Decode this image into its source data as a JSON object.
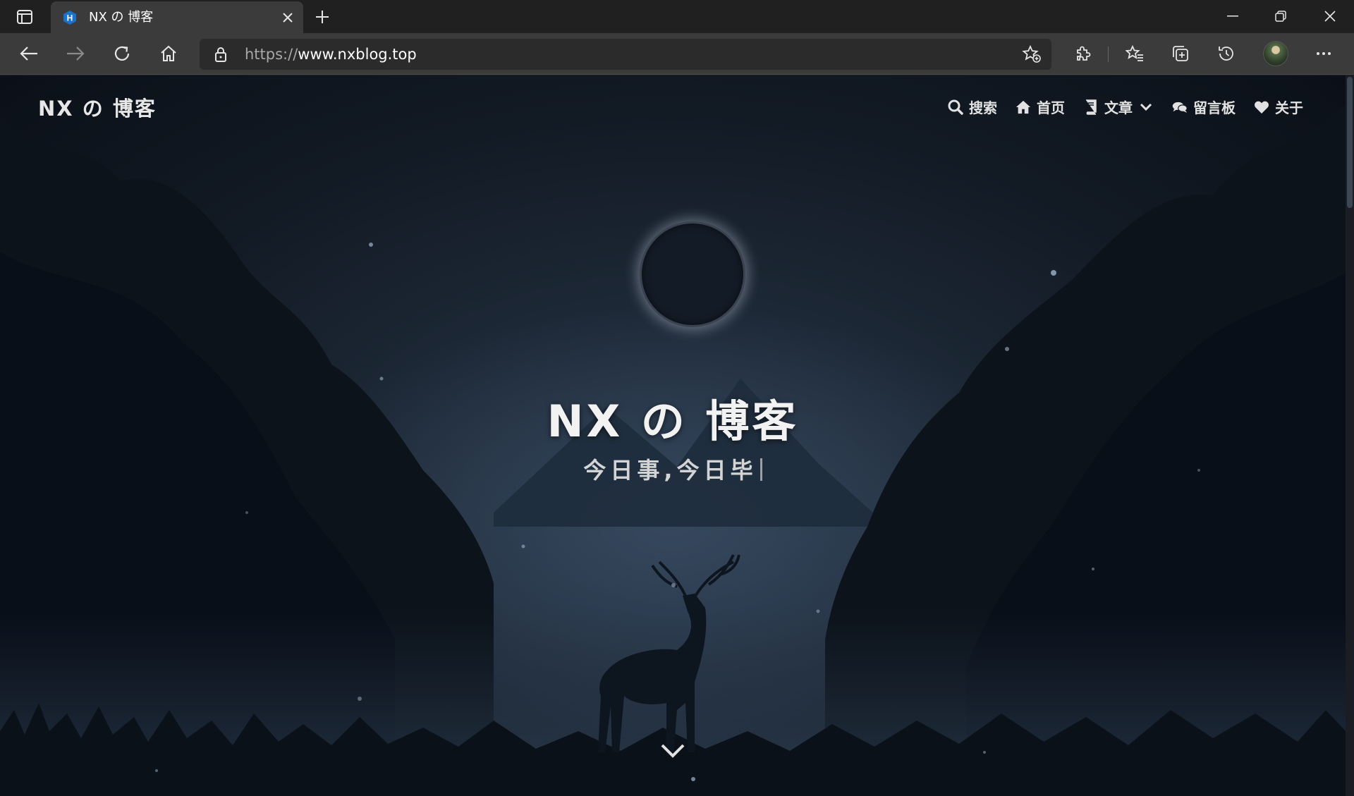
{
  "browser": {
    "tab": {
      "title": "NX の 博客",
      "favicon_letter": "H"
    },
    "address": {
      "protocol": "https://",
      "host": "www.nxblog.top"
    }
  },
  "site": {
    "brand": "NX の 博客",
    "nav": [
      {
        "label": "搜索",
        "icon": "search-icon"
      },
      {
        "label": "首页",
        "icon": "home-icon"
      },
      {
        "label": "文章",
        "icon": "book-icon",
        "dropdown": true
      },
      {
        "label": "留言板",
        "icon": "comments-icon"
      },
      {
        "label": "关于",
        "icon": "heart-icon"
      }
    ],
    "hero": {
      "title": "NX の 博客",
      "subtitle": "今日事,今日毕"
    }
  },
  "colors": {
    "chrome_bg": "#202020",
    "toolbar_bg": "#3b3b3b",
    "page_bg": "#121a24",
    "favicon": "#1a73c8"
  }
}
